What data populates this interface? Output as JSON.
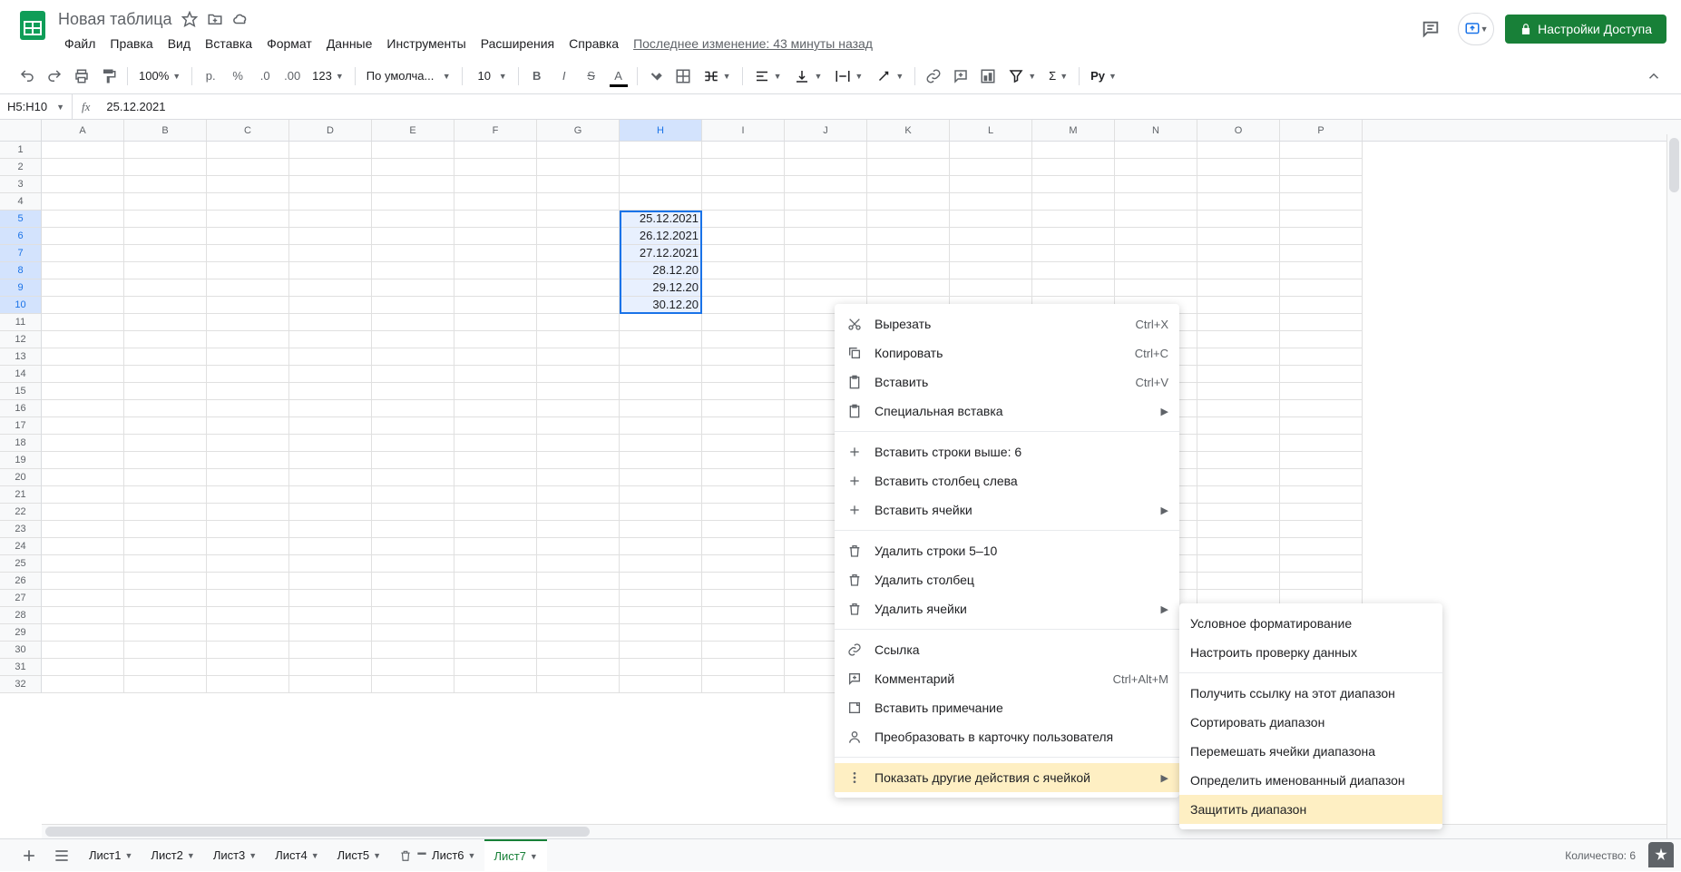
{
  "doc": {
    "title": "Новая таблица"
  },
  "menus": [
    "Файл",
    "Правка",
    "Вид",
    "Вставка",
    "Формат",
    "Данные",
    "Инструменты",
    "Расширения",
    "Справка"
  ],
  "last_edit": "Последнее изменение: 43 минуты назад",
  "share_button": "Настройки Доступа",
  "toolbar": {
    "zoom": "100%",
    "currency_sym": "р.",
    "number_format": "123",
    "font": "По умолча...",
    "font_size": "10"
  },
  "name_box": "H5:H10",
  "formula": "25.12.2021",
  "columns": [
    "A",
    "B",
    "C",
    "D",
    "E",
    "F",
    "G",
    "H",
    "I",
    "J",
    "K",
    "L",
    "M",
    "N",
    "O",
    "P"
  ],
  "selected_col_index": 7,
  "selected_rows": [
    5,
    6,
    7,
    8,
    9,
    10
  ],
  "row_count": 32,
  "cells": {
    "H5": "25.12.2021",
    "H6": "26.12.2021",
    "H7": "27.12.2021",
    "H8": "28.12.20",
    "H9": "29.12.20",
    "H10": "30.12.20"
  },
  "context_menu": {
    "items": [
      {
        "icon": "cut",
        "label": "Вырезать",
        "shortcut": "Ctrl+X"
      },
      {
        "icon": "copy",
        "label": "Копировать",
        "shortcut": "Ctrl+C"
      },
      {
        "icon": "paste",
        "label": "Вставить",
        "shortcut": "Ctrl+V"
      },
      {
        "icon": "paste",
        "label": "Специальная вставка",
        "sub": true
      },
      {
        "sep": true
      },
      {
        "icon": "plus",
        "label": "Вставить строки выше: 6"
      },
      {
        "icon": "plus",
        "label": "Вставить столбец слева"
      },
      {
        "icon": "plus",
        "label": "Вставить ячейки",
        "sub": true
      },
      {
        "sep": true
      },
      {
        "icon": "trash",
        "label": "Удалить строки 5–10"
      },
      {
        "icon": "trash",
        "label": "Удалить столбец"
      },
      {
        "icon": "trash",
        "label": "Удалить ячейки",
        "sub": true
      },
      {
        "sep": true
      },
      {
        "icon": "link",
        "label": "Ссылка"
      },
      {
        "icon": "comment",
        "label": "Комментарий",
        "shortcut": "Ctrl+Alt+M"
      },
      {
        "icon": "note",
        "label": "Вставить примечание"
      },
      {
        "icon": "person",
        "label": "Преобразовать в карточку пользователя"
      },
      {
        "sep": true
      },
      {
        "icon": "more",
        "label": "Показать другие действия с ячейкой",
        "sub": true,
        "hl": true
      }
    ]
  },
  "submenu": {
    "items": [
      "Условное форматирование",
      "Настроить проверку данных",
      null,
      "Получить ссылку на этот диапазон",
      "Сортировать диапазон",
      "Перемешать ячейки диапазона",
      "Определить именованный диапазон",
      "Защитить диапазон"
    ],
    "hl_index": 7
  },
  "sheets": [
    "Лист1",
    "Лист2",
    "Лист3",
    "Лист4",
    "Лист5",
    "Лист6",
    "Лист7"
  ],
  "active_sheet": 6,
  "trash_sheet_index": 5,
  "status": "Количество: 6"
}
